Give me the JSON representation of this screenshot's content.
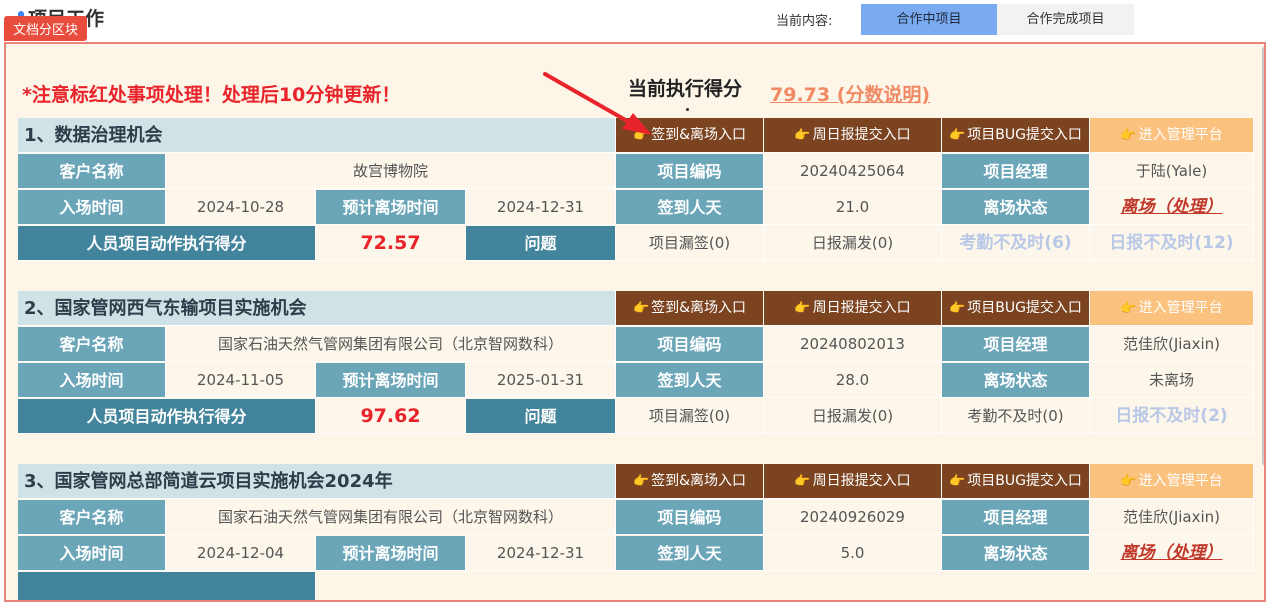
{
  "header": {
    "title": "项目工作",
    "current_label": "当前内容:",
    "tabs": [
      {
        "label": "合作中项目",
        "active": true
      },
      {
        "label": "合作完成项目",
        "active": false
      }
    ]
  },
  "badge": "文档分区块",
  "notice": "*注意标红处事项处理！处理后10分钟更新！",
  "score_title": "当前执行得分",
  "score_value": "79.73 (分数说明)",
  "labels": {
    "customer": "客户名称",
    "entry_time": "入场时间",
    "exit_plan": "预计离场时间",
    "person_score": "人员项目动作执行得分",
    "issues": "问题",
    "project_code": "项目编码",
    "sign_days": "签到人天",
    "manager": "项目经理",
    "exit_status": "离场状态"
  },
  "buttons": {
    "sign": "签到&离场入口",
    "weekly": "周日报提交入口",
    "bug": "项目BUG提交入口",
    "admin": "进入管理平台"
  },
  "projects": [
    {
      "name": "1、数据治理机会",
      "customer": "故宫博物院",
      "code": "20240425064",
      "manager": "于陆(Yale)",
      "entry": "2024-10-28",
      "exit_plan": "2024-12-31",
      "sign_days": "21.0",
      "exit_status": "离场（处理）",
      "score": "72.57",
      "miss_sign": "项目漏签(0)",
      "miss_daily": "日报漏发(0)",
      "attendance": "考勤不及时(6)",
      "daily_late": "日报不及时(12)"
    },
    {
      "name": "2、国家管网西气东输项目实施机会",
      "customer": "国家石油天然气管网集团有限公司（北京智网数科）",
      "code": "20240802013",
      "manager": "范佳欣(Jiaxin)",
      "entry": "2024-11-05",
      "exit_plan": "2025-01-31",
      "sign_days": "28.0",
      "exit_status": "未离场",
      "score": "97.62",
      "miss_sign": "项目漏签(0)",
      "miss_daily": "日报漏发(0)",
      "attendance": "考勤不及时(0)",
      "daily_late": "日报不及时(2)"
    },
    {
      "name": "3、国家管网总部简道云项目实施机会2024年",
      "customer": "国家石油天然气管网集团有限公司（北京智网数科）",
      "code": "20240926029",
      "manager": "范佳欣(Jiaxin)",
      "entry": "2024-12-04",
      "exit_plan": "2024-12-31",
      "sign_days": "5.0",
      "exit_status": "离场（处理）"
    }
  ],
  "colors": {
    "accent_tab": "#7aaaf0",
    "warning_red": "#e8242a",
    "button_brown": "#7b4320",
    "button_light": "#fbc17e",
    "label_teal": "#6aa5b8"
  }
}
